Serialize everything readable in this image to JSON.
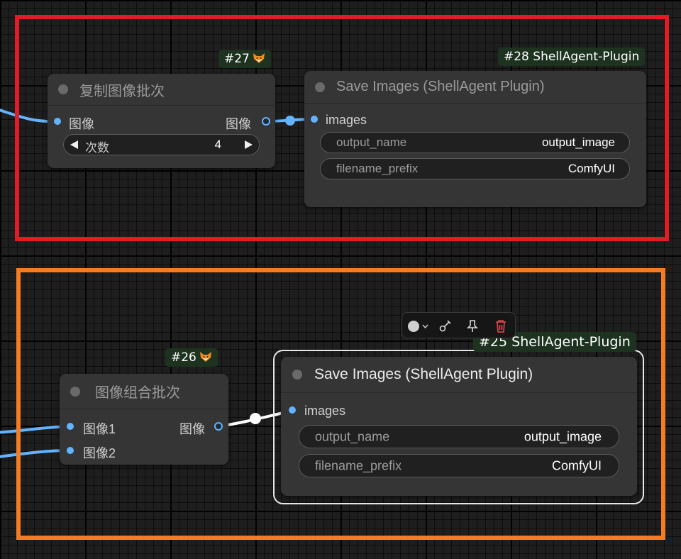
{
  "colors": {
    "group_top": "#e21b24",
    "group_bottom": "#f57c23",
    "image_slot": "#63b3ff",
    "badge_bg": "#1d3320",
    "delete_icon": "#e5484d"
  },
  "nodes": {
    "n27": {
      "badge": "#27",
      "badge_icon": "fox-icon",
      "title": "复制图像批次",
      "input": "图像",
      "output": "图像",
      "widget": {
        "prev_icon": "left-triangle-icon",
        "name": "次数",
        "value": "4",
        "next_icon": "right-triangle-icon"
      }
    },
    "n28": {
      "badge": "#28 ShellAgent-Plugin",
      "title": "Save Images (ShellAgent Plugin)",
      "input": "images",
      "widgets": [
        {
          "name": "output_name",
          "value": "output_image"
        },
        {
          "name": "filename_prefix",
          "value": "ComfyUI"
        }
      ]
    },
    "n26": {
      "badge": "#26",
      "badge_icon": "fox-icon",
      "title": "图像组合批次",
      "inputs": [
        "图像1",
        "图像2"
      ],
      "output": "图像"
    },
    "n25": {
      "badge": "#25 ShellAgent-Plugin",
      "title": "Save Images (ShellAgent Plugin)",
      "input": "images",
      "selected": true,
      "widgets": [
        {
          "name": "output_name",
          "value": "output_image"
        },
        {
          "name": "filename_prefix",
          "value": "ComfyUI"
        }
      ]
    }
  },
  "selection_toolbar": {
    "items": [
      "color-picker-icon",
      "chevron-down-icon",
      "bypass-wand-icon",
      "pin-icon",
      "trash-icon"
    ]
  }
}
